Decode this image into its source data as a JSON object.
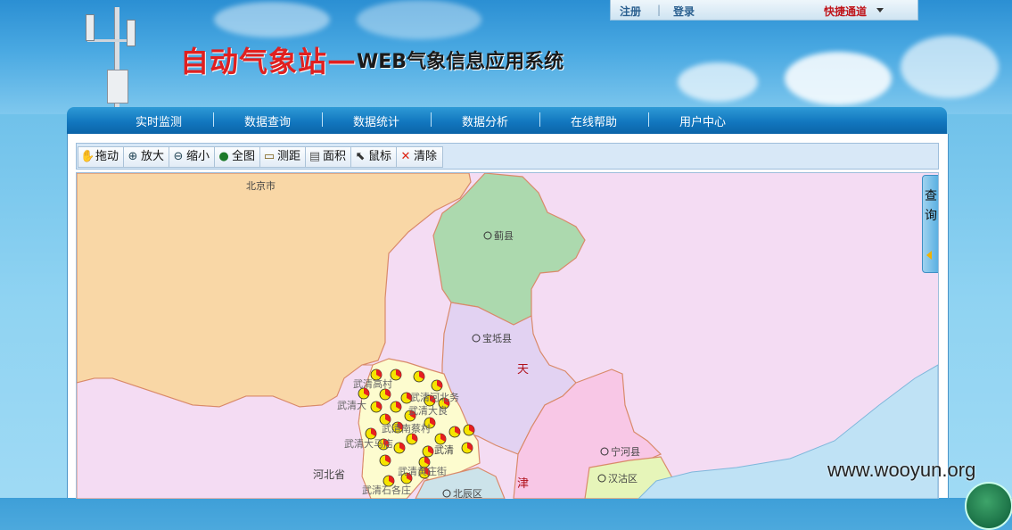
{
  "header": {
    "title_main": "自动气象站",
    "title_dash": "—",
    "title_sub": "WEB气象信息应用系统",
    "links": {
      "register": "注册",
      "separator": "|",
      "login": "登录",
      "quick": "快捷通道"
    }
  },
  "nav": {
    "items": [
      {
        "label": "实时监测"
      },
      {
        "label": "数据查询"
      },
      {
        "label": "数据统计"
      },
      {
        "label": "数据分析"
      },
      {
        "label": "在线帮助"
      },
      {
        "label": "用户中心"
      }
    ]
  },
  "toolbar": {
    "buttons": [
      {
        "label": "拖动",
        "icon": "hand-icon"
      },
      {
        "label": "放大",
        "icon": "zoom-in-icon"
      },
      {
        "label": "缩小",
        "icon": "zoom-out-icon"
      },
      {
        "label": "全图",
        "icon": "globe-icon"
      },
      {
        "label": "测距",
        "icon": "ruler-icon"
      },
      {
        "label": "面积",
        "icon": "area-icon"
      },
      {
        "label": "鼠标",
        "icon": "cursor-icon"
      },
      {
        "label": "清除",
        "icon": "close-icon"
      }
    ]
  },
  "map": {
    "labels": {
      "beijing": "北京市",
      "jixian": "蓟县",
      "baodi": "宝坻县",
      "tian": "天",
      "jin": "津",
      "hebei": "河北省",
      "ninghe": "宁河县",
      "hangu": "汉沽区",
      "wuqing": "武清",
      "beichen": "北辰区",
      "gaocun": "武清高村",
      "hexiwu": "武清河北务",
      "dadi": "武清大良",
      "nancai": "武清南蔡村",
      "dawangu": "武清大王古",
      "madian": "武清大马店",
      "huangzhuang": "武清黄庄街",
      "shiges": "武清石各庄",
      "wq_other": "武清大"
    },
    "side_panel": {
      "label_line1": "查",
      "label_line2": "询"
    }
  },
  "watermark": "www.wooyun.org",
  "colors": {
    "nav_top": "#2e9ad6",
    "nav_bottom": "#0b64a8",
    "title_red": "#e02020",
    "beijing_fill": "#f9d7a6",
    "jixian_fill": "#acd9ae",
    "baodi_fill": "#e2d2f2",
    "wuqing_fill": "#fdfccf",
    "ninghe_fill": "#f8c7e6",
    "hangu_fill": "#e6f5b9",
    "hebei_fill": "#f4dcf3",
    "sea_fill": "#bfe2f5",
    "station_red": "#e62020",
    "station_yellow": "#f5e400"
  }
}
